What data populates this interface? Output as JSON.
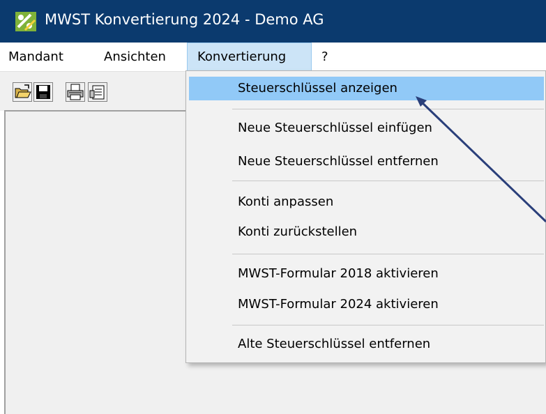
{
  "window": {
    "title": "MWST Konvertierung 2024 - Demo AG",
    "titlebar_color": "#0b3a6e"
  },
  "menubar": {
    "items": [
      {
        "label": "Mandant"
      },
      {
        "label": "Ansichten"
      },
      {
        "label": "Konvertierung",
        "active": true
      },
      {
        "label": "?"
      }
    ]
  },
  "toolbar": {
    "buttons": [
      {
        "icon": "open-folder-icon"
      },
      {
        "icon": "save-disk-icon"
      },
      {
        "icon": "printer-icon"
      },
      {
        "icon": "properties-icon"
      }
    ]
  },
  "dropdown": {
    "items": [
      {
        "label": "Steuerschlüssel anzeigen",
        "highlighted": true
      },
      {
        "label": "Neue Steuerschlüssel einfügen"
      },
      {
        "label": "Neue Steuerschlüssel entfernen"
      },
      {
        "label": "Konti anpassen"
      },
      {
        "label": "Konti zurückstellen"
      },
      {
        "label": "MWST-Formular 2018 aktivieren"
      },
      {
        "label": "MWST-Formular 2024 aktivieren"
      },
      {
        "label": "Alte Steuerschlüssel entfernen"
      }
    ],
    "highlight_color": "#91c9f7"
  },
  "annotation": {
    "arrow_color": "#2a3f7a"
  }
}
